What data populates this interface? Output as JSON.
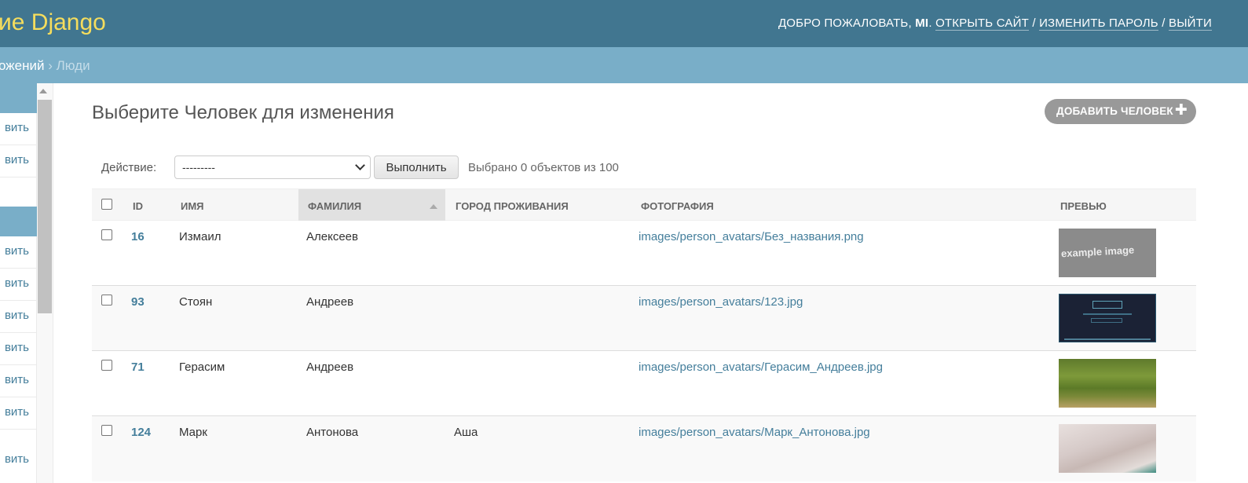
{
  "header": {
    "site_name": "ие Django",
    "welcome_text": "ДОБРО ПОЖАЛОВАТЬ,",
    "username": "MI",
    "view_site": "ОТКРЫТЬ САЙТ",
    "change_password": "ИЗМЕНИТЬ ПАРОЛЬ",
    "logout": "ВЫЙТИ",
    "separator": "/"
  },
  "breadcrumbs": {
    "app": "ожений",
    "sep": "›",
    "current": "Люди"
  },
  "sidebar": {
    "link_label": "вить"
  },
  "main": {
    "title": "Выберите Человек для изменения",
    "add_button": "ДОБАВИТЬ ЧЕЛОВЕК",
    "action_label": "Действие:",
    "action_selected": "---------",
    "run_button": "Выполнить",
    "selection_count": "Выбрано 0 объектов из 100"
  },
  "table": {
    "columns": [
      "ID",
      "ИМЯ",
      "ФАМИЛИЯ",
      "ГОРОД ПРОЖИВАНИЯ",
      "ФОТОГРАФИЯ",
      "ПРЕВЬЮ"
    ],
    "sorted_column": "ФАМИЛИЯ",
    "rows": [
      {
        "id": "16",
        "first_name": "Измаил",
        "last_name": "Алексеев",
        "city": "",
        "photo": "images/person_avatars/Без_названия.png",
        "preview": "example image"
      },
      {
        "id": "93",
        "first_name": "Стоян",
        "last_name": "Андреев",
        "city": "",
        "photo": "images/person_avatars/123.jpg",
        "preview": ""
      },
      {
        "id": "71",
        "first_name": "Герасим",
        "last_name": "Андреев",
        "city": "",
        "photo": "images/person_avatars/Герасим_Андреев.jpg",
        "preview": ""
      },
      {
        "id": "124",
        "first_name": "Марк",
        "last_name": "Антонова",
        "city": "Аша",
        "photo": "images/person_avatars/Марк_Антонова.jpg",
        "preview": ""
      }
    ]
  },
  "colors": {
    "header_bg": "#417690",
    "breadcrumb_bg": "#79aec8",
    "site_name": "#f5dd5d",
    "link": "#447e9b"
  },
  "icons": {
    "add": "plus-icon",
    "sort": "sort-ascending-icon",
    "select": "chevron-down-icon"
  }
}
